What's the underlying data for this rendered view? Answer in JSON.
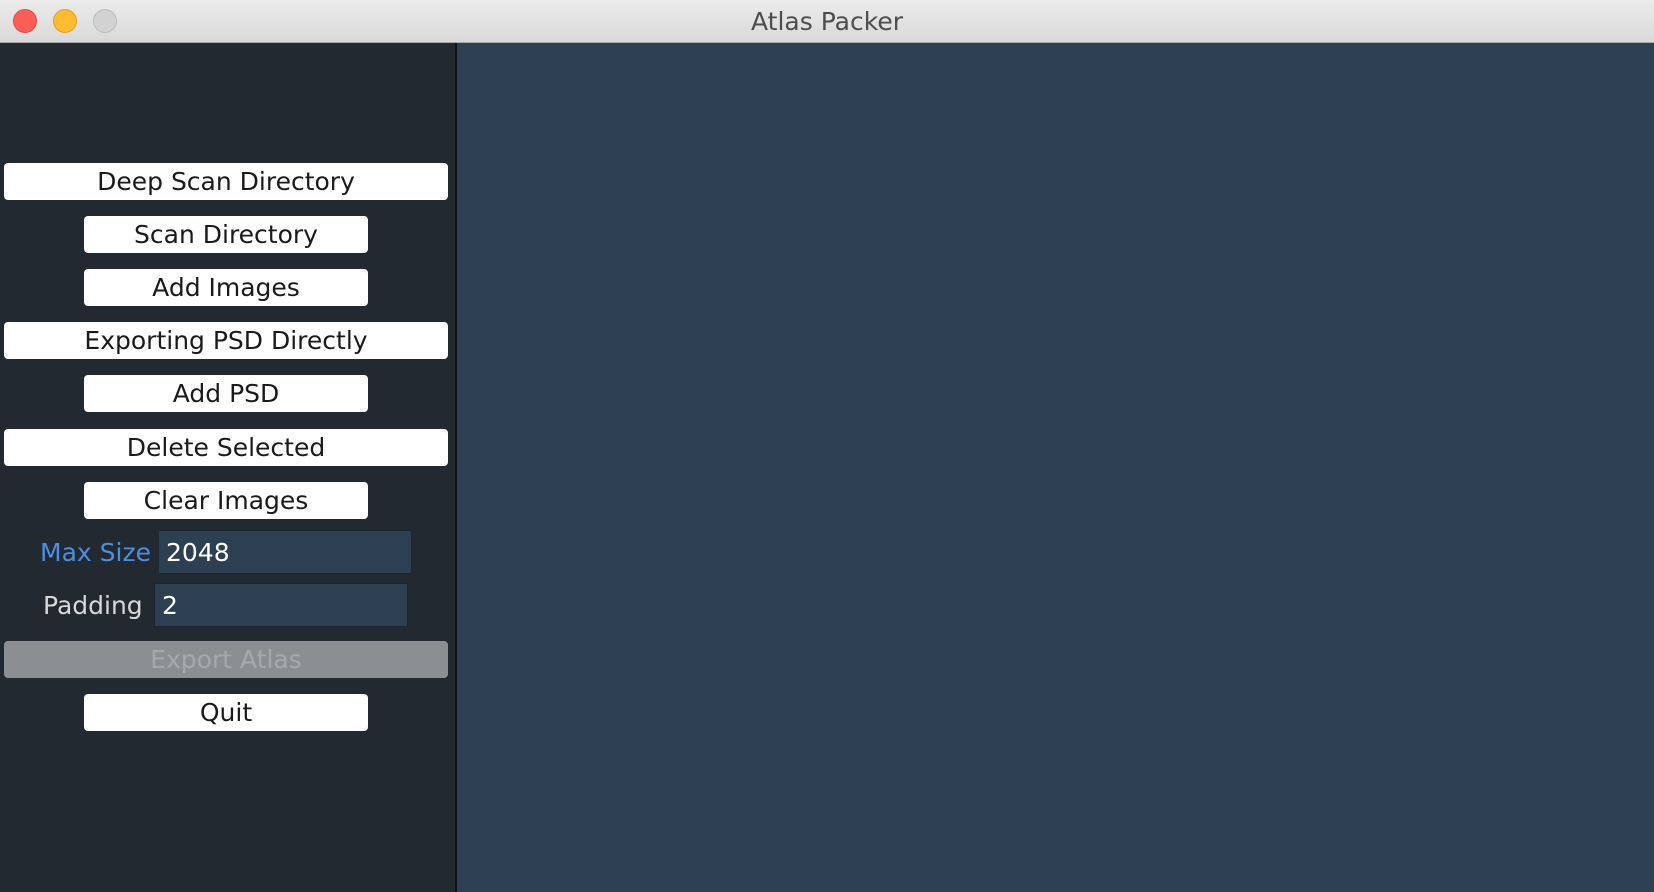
{
  "window": {
    "title": "Atlas Packer"
  },
  "sidebar": {
    "buttons": {
      "deep_scan": "Deep Scan Directory",
      "scan": "Scan Directory",
      "add_images": "Add Images",
      "export_psd": "Exporting PSD Directly",
      "add_psd": "Add PSD",
      "delete_selected": "Delete Selected",
      "clear_images": "Clear Images",
      "export_atlas": "Export Atlas",
      "quit": "Quit"
    },
    "fields": {
      "max_size": {
        "label": "Max Size",
        "value": "2048"
      },
      "padding": {
        "label": "Padding",
        "value": "2"
      }
    }
  },
  "colors": {
    "sidebar_bg": "#222931",
    "canvas_bg": "#2d4051",
    "accent": "#4a90e2",
    "disabled_button": "#8c8f92"
  }
}
